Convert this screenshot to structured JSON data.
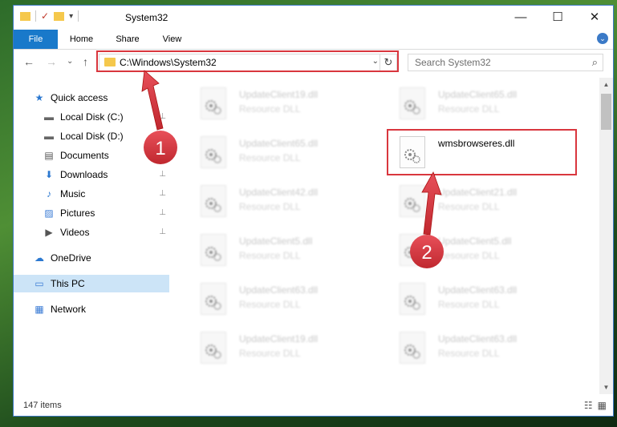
{
  "window": {
    "title": "System32",
    "minimize_symbol": "—",
    "maximize_symbol": "☐",
    "close_symbol": "✕"
  },
  "ribbon": {
    "tabs": [
      "File",
      "Home",
      "Share",
      "View"
    ],
    "expand_symbol": "⌄"
  },
  "address": {
    "path": "C:\\Windows\\System32",
    "back_symbol": "←",
    "forward_symbol": "→",
    "recent_symbol": "⌄",
    "up_symbol": "↑",
    "dropdown_symbol": "⌄",
    "refresh_symbol": "↻"
  },
  "search": {
    "placeholder": "Search System32",
    "icon_symbol": "⌕"
  },
  "sidebar": {
    "items": [
      {
        "label": "Quick access",
        "icon": "star-icon",
        "glyph": "★",
        "pinned": false
      },
      {
        "label": "Local Disk (C:)",
        "icon": "disk-icon",
        "glyph": "▬",
        "pinned": true
      },
      {
        "label": "Local Disk (D:)",
        "icon": "disk-icon",
        "glyph": "▬",
        "pinned": true
      },
      {
        "label": "Documents",
        "icon": "documents-icon",
        "glyph": "▤",
        "pinned": true
      },
      {
        "label": "Downloads",
        "icon": "downloads-icon",
        "glyph": "⬇",
        "pinned": true
      },
      {
        "label": "Music",
        "icon": "music-icon",
        "glyph": "♪",
        "pinned": true
      },
      {
        "label": "Pictures",
        "icon": "pictures-icon",
        "glyph": "▨",
        "pinned": true
      },
      {
        "label": "Videos",
        "icon": "videos-icon",
        "glyph": "▶",
        "pinned": true
      },
      {
        "label": "OneDrive",
        "icon": "cloud-icon",
        "glyph": "☁",
        "pinned": false
      },
      {
        "label": "This PC",
        "icon": "computer-icon",
        "glyph": "▭",
        "pinned": false,
        "selected": true
      },
      {
        "label": "Network",
        "icon": "network-icon",
        "glyph": "▦",
        "pinned": false
      }
    ],
    "pin_symbol": "📌"
  },
  "files": [
    {
      "name": "UpdateClient19.dll",
      "type": "Resource DLL"
    },
    {
      "name": "UpdateClient65.dll",
      "type": "Resource DLL"
    },
    {
      "name": "UpdateClient65.dll",
      "type": "Resource DLL"
    },
    {
      "name": "wmsbrowseres.dll",
      "type": ""
    },
    {
      "name": "UpdateClient42.dll",
      "type": "Resource DLL"
    },
    {
      "name": "UpdateClient21.dll",
      "type": "Resource DLL"
    },
    {
      "name": "UpdateClient5.dll",
      "type": "Resource DLL"
    },
    {
      "name": "UpdateClient5.dll",
      "type": "Resource DLL"
    },
    {
      "name": "UpdateClient63.dll",
      "type": "Resource DLL"
    },
    {
      "name": "UpdateClient63.dll",
      "type": "Resource DLL"
    },
    {
      "name": "UpdateClient19.dll",
      "type": "Resource DLL"
    },
    {
      "name": "UpdateClient63.dll",
      "type": "Resource DLL"
    }
  ],
  "status": {
    "item_count": "147 items",
    "details_view_symbol": "☷",
    "tiles_view_symbol": "▦"
  },
  "annotations": {
    "step1": "1",
    "step2": "2",
    "highlight_color": "#d9363e"
  },
  "qat": {
    "properties_symbol": "✓",
    "customize_symbol": "▾"
  }
}
